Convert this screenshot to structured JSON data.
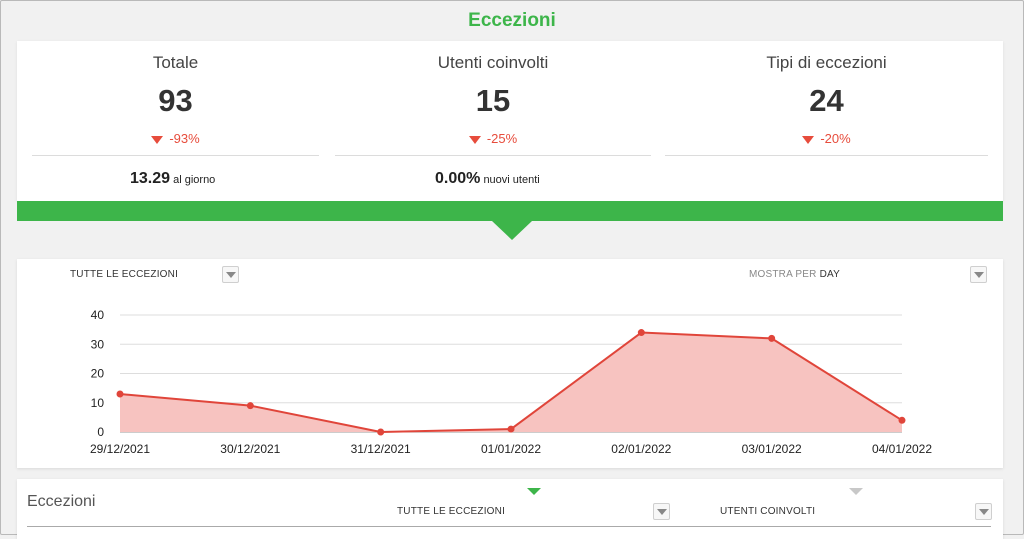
{
  "page_title": "Eccezioni",
  "stats": [
    {
      "label": "Totale",
      "value": "93",
      "delta": "-93%"
    },
    {
      "label": "Utenti coinvolti",
      "value": "15",
      "delta": "-25%"
    },
    {
      "label": "Tipi di eccezioni",
      "value": "24",
      "delta": "-20%"
    }
  ],
  "sub_stats": {
    "per_day_value": "13.29",
    "per_day_label": "al giorno",
    "new_users_value": "0.00%",
    "new_users_label": "nuovi utenti"
  },
  "chart_controls": {
    "filter_label": "TUTTE LE ECCEZIONI",
    "show_by_label": "MOSTRA PER",
    "show_by_value": "DAY"
  },
  "chart_data": {
    "type": "area",
    "categories": [
      "29/12/2021",
      "30/12/2021",
      "31/12/2021",
      "01/01/2022",
      "02/01/2022",
      "03/01/2022",
      "04/01/2022"
    ],
    "values": [
      13,
      9,
      0,
      1,
      34,
      32,
      4
    ],
    "y_ticks": [
      "0",
      "10",
      "20",
      "30",
      "40"
    ],
    "ylim": [
      0,
      40
    ],
    "grid": true,
    "line_color": "#e0453a",
    "fill_color": "#f7c3c0"
  },
  "bottom_table": {
    "title": "Eccezioni",
    "col1_label": "TUTTE LE ECCEZIONI",
    "col2_label": "UTENTI COINVOLTI"
  },
  "colors": {
    "accent_green": "#3db54a",
    "negative_red": "#e74c3c"
  }
}
